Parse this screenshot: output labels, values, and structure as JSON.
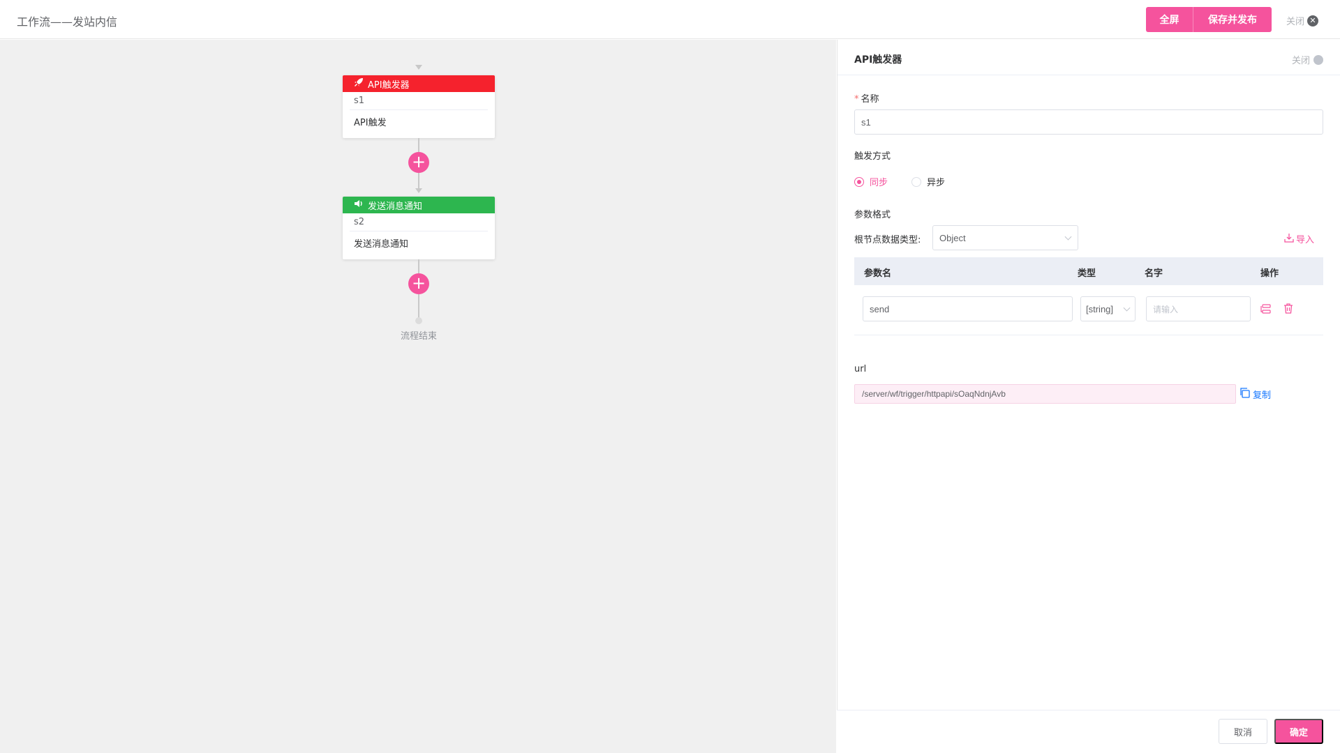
{
  "header": {
    "title": "工作流——发站内信",
    "fullscreen_label": "全屏",
    "save_publish_label": "保存并发布",
    "close_label": "关闭"
  },
  "flow": {
    "nodes": [
      {
        "type_label": "API触发器",
        "id": "s1",
        "description": "API触发",
        "color": "#f5222d",
        "icon": "rocket-icon"
      },
      {
        "type_label": "发送消息通知",
        "id": "s2",
        "description": "发送消息通知",
        "color": "#2db64f",
        "icon": "speaker-icon"
      }
    ],
    "add_symbol": "+",
    "end_label": "流程结束"
  },
  "panel": {
    "title": "API触发器",
    "close_label": "关闭",
    "name_label": "名称",
    "name_required_mark": "*",
    "name_value": "s1",
    "trigger_mode_label": "触发方式",
    "trigger_options": [
      {
        "label": "同步",
        "checked": true
      },
      {
        "label": "异步",
        "checked": false
      }
    ],
    "param_format_label": "参数格式",
    "root_type_label": "根节点数据类型:",
    "root_type_value": "Object",
    "import_label": "导入",
    "table": {
      "headers": [
        "参数名",
        "类型",
        "名字",
        "操作"
      ],
      "rows": [
        {
          "param_name": "send",
          "type": "[string]",
          "name_placeholder": "请输入"
        }
      ]
    },
    "url_label": "url",
    "url_value": "/server/wf/trigger/httpapi/sOaqNdnjAvb",
    "copy_label": "复制",
    "cancel_label": "取消",
    "confirm_label": "确定"
  },
  "colors": {
    "accent": "#f5539d",
    "trigger_red": "#f5222d",
    "notify_green": "#2db64f",
    "link_blue": "#1677ff"
  }
}
